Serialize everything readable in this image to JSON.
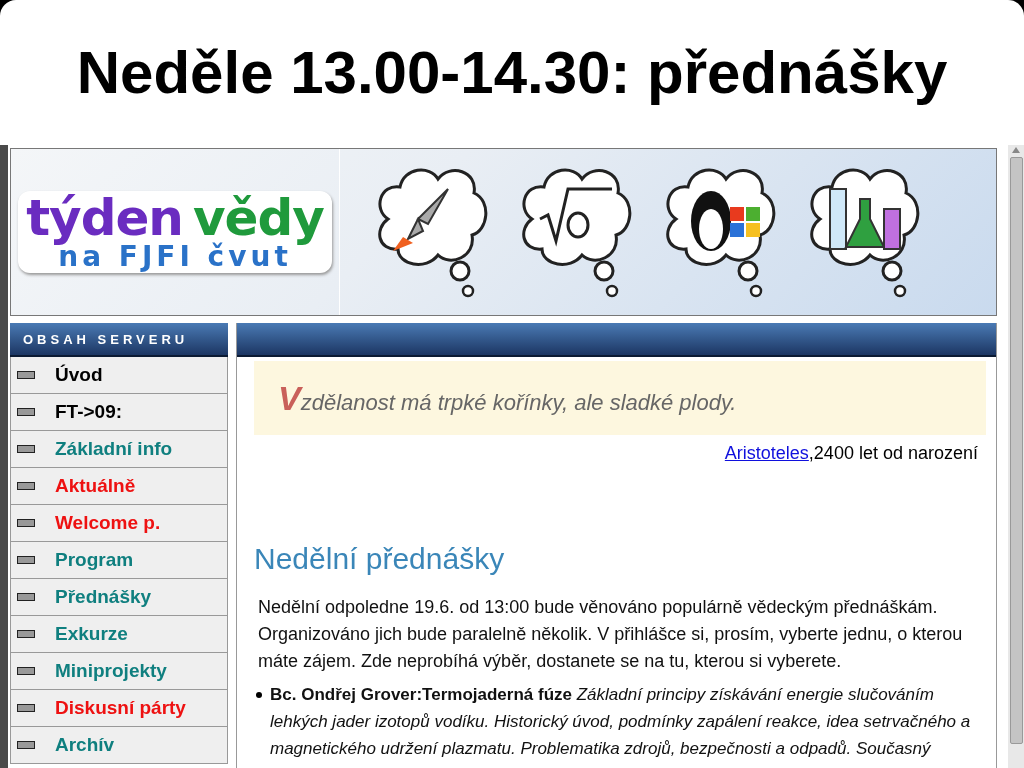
{
  "slide": {
    "title": "Neděle 13.00-14.30: přednášky"
  },
  "banner": {
    "logo": {
      "line_1_word_1": "týden",
      "line_1_word_2": "vědy",
      "line_2": "na FJFI čvut"
    }
  },
  "sidebar": {
    "heading": "OBSAH SERVERU",
    "items": [
      {
        "label": "Úvod",
        "color": "#000000"
      },
      {
        "label": "FT->09:",
        "color": "#000000"
      },
      {
        "label": "Základní info",
        "color": "#0f7f7f"
      },
      {
        "label": "Aktuálně",
        "color": "#ee1111"
      },
      {
        "label": "Welcome p.",
        "color": "#ee1111"
      },
      {
        "label": "Program",
        "color": "#0f7f7f"
      },
      {
        "label": "Přednášky",
        "color": "#0f7f7f"
      },
      {
        "label": "Exkurze",
        "color": "#0f7f7f"
      },
      {
        "label": "Miniprojekty",
        "color": "#0f7f7f"
      },
      {
        "label": "Diskusní párty",
        "color": "#ee1111"
      },
      {
        "label": "Archív",
        "color": "#0f7f7f"
      }
    ]
  },
  "content": {
    "quote": {
      "initial": "V",
      "text": "zdělanost má trpké kořínky, ale sladké plody."
    },
    "attribution": {
      "link": "Aristoteles",
      "text": ",2400 let od narození"
    },
    "heading": "Nedělní přednášky",
    "paragraph": "Nedělní odpoledne 19.6. od 13:00 bude věnováno populárně vědeckým přednáškám. Organizováno jich bude paralelně několik. V přihlášce si, prosím, vyberte jednu, o kterou máte zájem. Zde neprobíhá výběr, dostanete se na tu, kterou si vyberete.",
    "lectures": [
      "**Bc. Ondřej Grover:Termojaderná fúze** *Základní principy získávání energie slučováním lehkých jader izotopů vodíku. Historický úvod, podmínky zapálení reakce, idea setrvačného a magnetického udržení plazmatu. Problematika zdrojů, bezpečnosti a odpadů. Současný*"
    ]
  }
}
